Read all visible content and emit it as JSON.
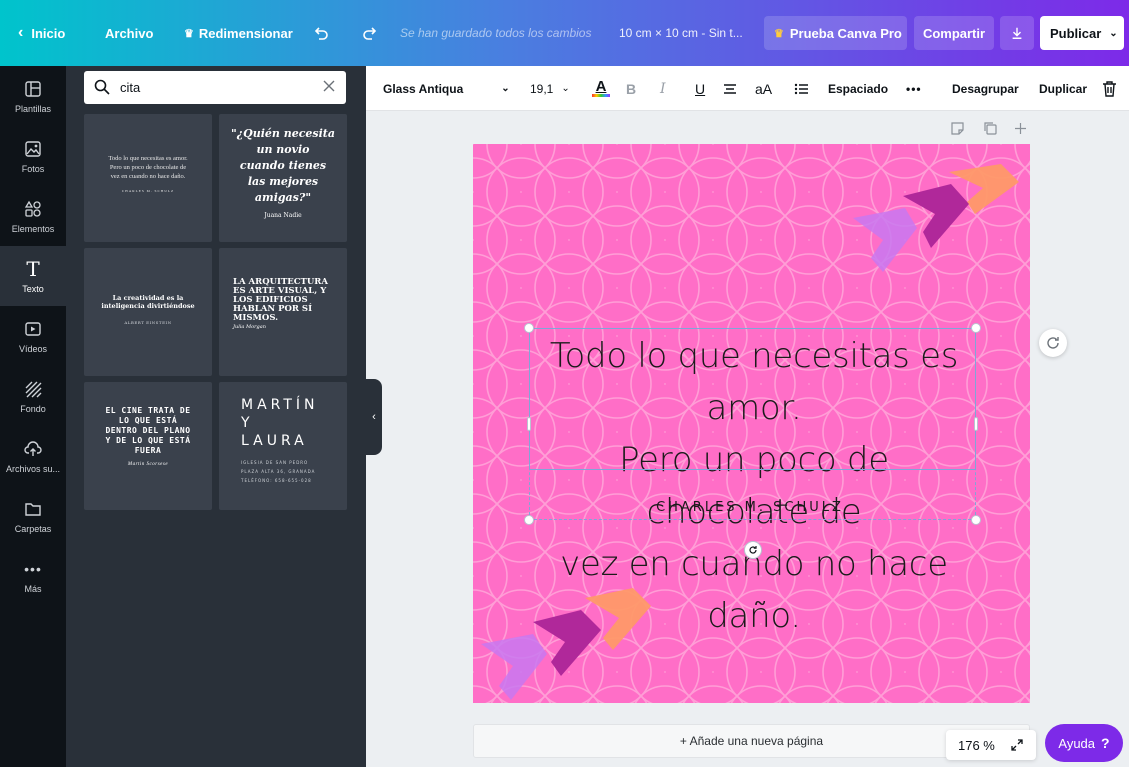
{
  "topbar": {
    "home": "Inicio",
    "file": "Archivo",
    "resize": "Redimensionar",
    "saved_status": "Se han guardado todos los cambios",
    "doc_size": "10 cm × 10 cm - Sin t...",
    "pro": "Prueba Canva Pro",
    "share": "Compartir",
    "publish": "Publicar"
  },
  "rail": {
    "items": [
      {
        "label": "Plantillas",
        "icon": "templates-icon"
      },
      {
        "label": "Fotos",
        "icon": "photos-icon"
      },
      {
        "label": "Elementos",
        "icon": "elements-icon"
      },
      {
        "label": "Texto",
        "icon": "text-icon"
      },
      {
        "label": "Vídeos",
        "icon": "videos-icon"
      },
      {
        "label": "Fondo",
        "icon": "background-icon"
      },
      {
        "label": "Archivos su...",
        "icon": "uploads-icon"
      },
      {
        "label": "Carpetas",
        "icon": "folders-icon"
      },
      {
        "label": "Más",
        "icon": "more-icon"
      }
    ]
  },
  "panel": {
    "search_value": "cita",
    "tiles": [
      {
        "lines": [
          "Todo lo que necesitas es amor.",
          "Pero un poco de chocolate de",
          "vez en cuando no hace daño."
        ],
        "author": "CHARLES M. SCHULZ"
      },
      {
        "lines": [
          "\"¿Quién necesita",
          "un novio",
          "cuando tienes",
          "las mejores",
          "amigas?\""
        ],
        "author": "Juana Nadie"
      },
      {
        "lines": [
          "La creatividad es la",
          "inteligencia divirtiéndose"
        ],
        "author": "ALBERT EINSTEIN"
      },
      {
        "lines": [
          "LA ARQUITECTURA",
          "ES ARTE VISUAL, Y",
          "LOS EDIFICIOS",
          "HABLAN POR SÍ",
          "MISMOS."
        ],
        "author": "Julia Morgan"
      },
      {
        "lines": [
          "EL CINE TRATA DE",
          "LO QUE ESTÁ",
          "DENTRO DEL PLANO",
          "Y DE LO QUE ESTÁ",
          "FUERA"
        ],
        "author": "Martin Scorsese"
      },
      {
        "lines": [
          "MARTÍN",
          "Y",
          "LAURA"
        ],
        "sub": [
          "IGLESIA DE SAN PEDRO",
          "PLAZA ALTA 36, GRANADA",
          "TELÉFONO: 658-655-028"
        ]
      }
    ]
  },
  "toolbar": {
    "font": "Glass Antiqua",
    "size": "19,1",
    "case": "aA",
    "spacing": "Espaciado",
    "more": "•••",
    "ungroup": "Desagrupar",
    "duplicate": "Duplicar"
  },
  "canvas": {
    "quote_lines": [
      "Todo lo que necesitas es amor.",
      "Pero un poco de chocolate de",
      "vez en cuando no hace daño."
    ],
    "author": "CHARLES M. SCHULZ",
    "bg_color": "#ff6ec7"
  },
  "footer": {
    "add_page": "+ Añade una nueva página",
    "zoom": "176 %",
    "help": "Ayuda"
  }
}
